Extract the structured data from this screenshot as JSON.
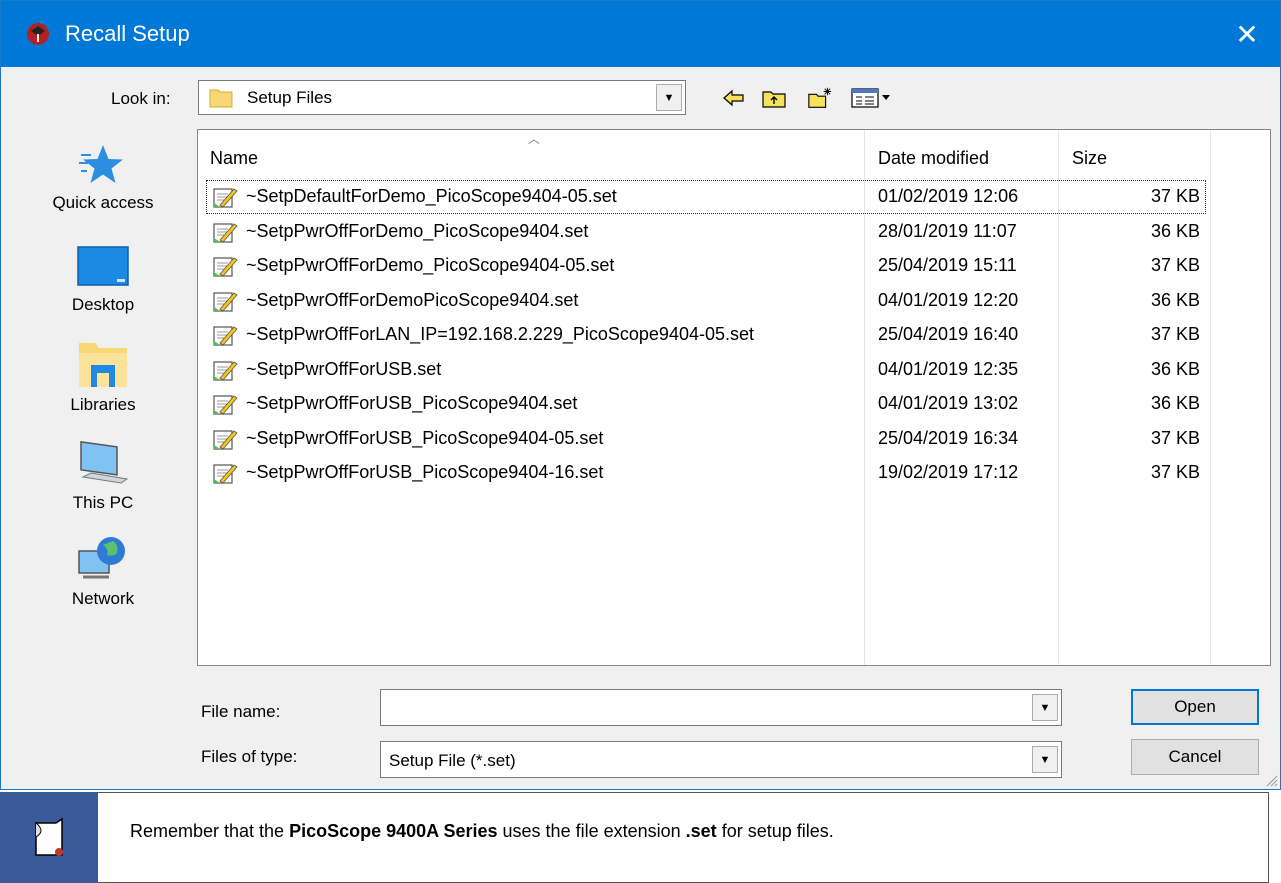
{
  "window": {
    "title": "Recall Setup",
    "close_glyph": "✕"
  },
  "toolbar": {
    "lookin_label": "Look in:",
    "lookin_value": "Setup Files",
    "icons": [
      "back-arrow-icon",
      "up-folder-icon",
      "new-folder-icon",
      "view-menu-icon"
    ]
  },
  "places": [
    {
      "label": "Quick access",
      "icon": "star-icon"
    },
    {
      "label": "Desktop",
      "icon": "desktop-icon"
    },
    {
      "label": "Libraries",
      "icon": "libraries-icon"
    },
    {
      "label": "This PC",
      "icon": "computer-icon"
    },
    {
      "label": "Network",
      "icon": "network-icon"
    }
  ],
  "columns": {
    "name": "Name",
    "date": "Date modified",
    "size": "Size"
  },
  "files": [
    {
      "name": "~SetpDefaultForDemo_PicoScope9404-05.set",
      "date": "01/02/2019 12:06",
      "size": "37 KB"
    },
    {
      "name": "~SetpPwrOffForDemo_PicoScope9404.set",
      "date": "28/01/2019 11:07",
      "size": "36 KB"
    },
    {
      "name": "~SetpPwrOffForDemo_PicoScope9404-05.set",
      "date": "25/04/2019 15:11",
      "size": "37 KB"
    },
    {
      "name": "~SetpPwrOffForDemoPicoScope9404.set",
      "date": "04/01/2019 12:20",
      "size": "36 KB"
    },
    {
      "name": "~SetpPwrOffForLAN_IP=192.168.2.229_PicoScope9404-05.set",
      "date": "25/04/2019 16:40",
      "size": "37 KB"
    },
    {
      "name": "~SetpPwrOffForUSB.set",
      "date": "04/01/2019 12:35",
      "size": "36 KB"
    },
    {
      "name": "~SetpPwrOffForUSB_PicoScope9404.set",
      "date": "04/01/2019 13:02",
      "size": "36 KB"
    },
    {
      "name": "~SetpPwrOffForUSB_PicoScope9404-05.set",
      "date": "25/04/2019 16:34",
      "size": "37 KB"
    },
    {
      "name": "~SetpPwrOffForUSB_PicoScope9404-16.set",
      "date": "19/02/2019 17:12",
      "size": "37 KB"
    }
  ],
  "form": {
    "filename_label": "File name:",
    "filename_value": "",
    "filetype_label": "Files of type:",
    "filetype_value": "Setup File (*.set)"
  },
  "buttons": {
    "open": "Open",
    "cancel": "Cancel"
  },
  "note": {
    "prefix": "Remember that the ",
    "product": "PicoScope 9400A Series",
    "middle": " uses the file extension ",
    "extension": ".set",
    "suffix": " for setup files."
  },
  "colors": {
    "titlebar": "#0078d7",
    "note_badge": "#3a5a99"
  }
}
